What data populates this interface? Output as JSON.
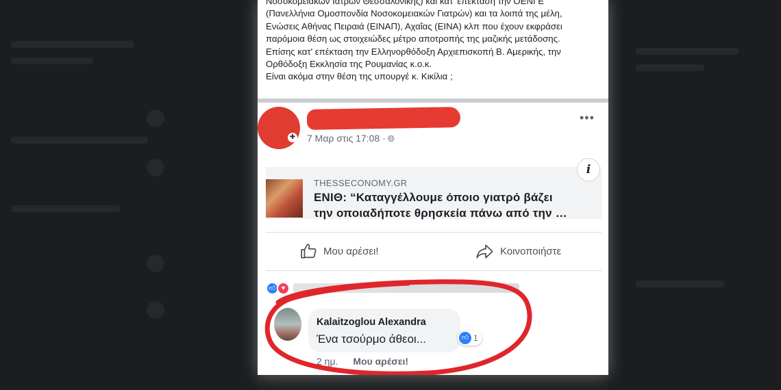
{
  "post_text": {
    "lines": [
      "Νοσοκομειακών Ιατρών Θεσσαλονίκης) και κατ' επέκταση την ΟΕΝΓΕ",
      "(Πανελλήνια Ομοσπονδία Νοσοκομειακών Γιατρών) και τα λοιπά της μέλη,",
      "Ενώσεις Αθήνας Πειραιά (ΕΙΝΑΠ), Αχαΐας (ΕΙΝΑ) κλπ που έχουν εκφράσει",
      "παρόμοια θέση ως στοιχειώδες μέτρο αποτροπής της μαζικής μετάδοσης.",
      "Επίσης κατ' επέκταση την Ελληνορθόδοξη Αρχιεπισκοπή Β. Αμερικής, την",
      "Ορθόδοξη Εκκλησία της Ρουμανίας κ.ο.κ.",
      "Είναι ακόμα στην θέση της υπουργέ κ. Κικίλια ;"
    ]
  },
  "shared_post": {
    "timestamp": "7 Μαρ στις 17:08 ·",
    "link": {
      "domain": "THESSECONOMY.GR",
      "title_line1": "ΕΝΙΘ: “Καταγγέλλουμε όποιο γιατρό βάζει",
      "title_line2": "την οποιαδήποτε θρησκεία πάνω από την …"
    }
  },
  "actions": {
    "like_label": "Μου αρέσει!",
    "share_label": "Κοινοποιήστε"
  },
  "comment": {
    "author": "Kalaitzoglou Alexandra",
    "text": "Ένα τσούρμο άθεοι...",
    "like_count": "1",
    "age": "2 ημ.",
    "like_link": "Μου αρέσει!"
  },
  "icons": {
    "more": "more-dots-icon",
    "globe": "globe-icon",
    "info": "info-icon",
    "like": "thumbs-up-icon",
    "share": "share-arrow-icon",
    "love": "heart-icon"
  },
  "colors": {
    "redaction": "#e53b33",
    "annotation_circle": "#e0262b",
    "facebook_blue": "#2d7ff9",
    "love_red": "#f33e58"
  }
}
